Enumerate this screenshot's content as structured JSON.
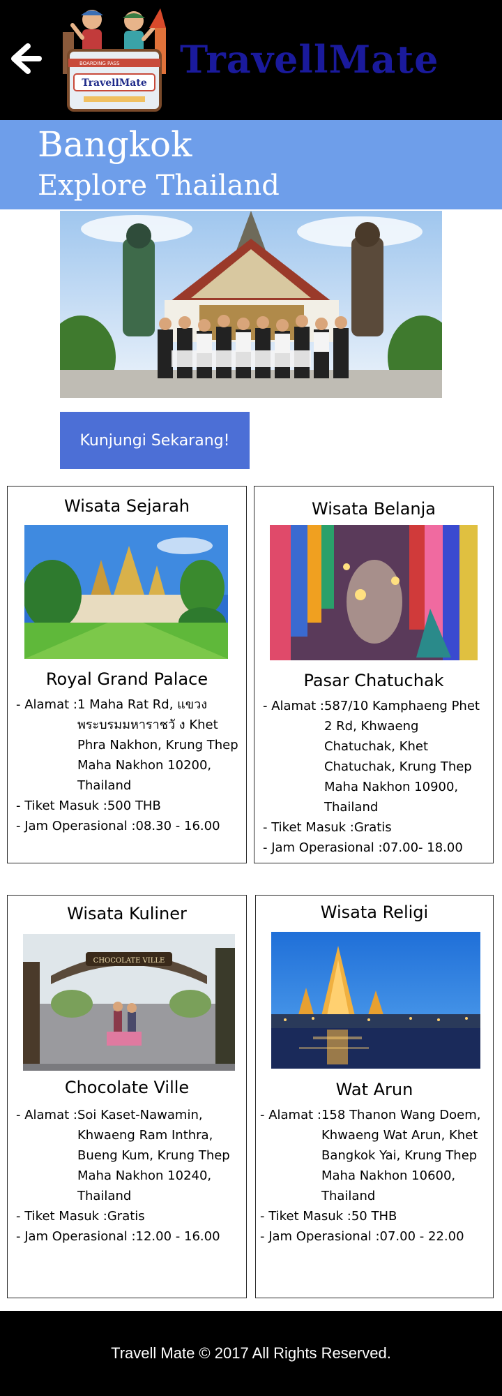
{
  "header": {
    "brand": "TravellMate",
    "logo_text": "TravellMate",
    "logo_ticket": "BOARDING PASS"
  },
  "hero": {
    "title": "Bangkok",
    "subtitle": "Explore Thailand",
    "cta": "Kunjungi Sekarang!"
  },
  "cards": [
    {
      "title": "Wisata Sejarah",
      "name": "Royal Grand Palace",
      "address": "1 Maha Rat Rd, แขวงพระบรมมหาราชวั ง Khet Phra Nakhon, Krung Thep Maha Nakhon 10200, Thailand",
      "ticket": "500 THB",
      "hours": "08.30 - 16.00"
    },
    {
      "title": "Wisata Belanja",
      "name": "Pasar Chatuchak",
      "address": "587/10 Kamphaeng Phet 2 Rd, Khwaeng Chatuchak, Khet Chatuchak, Krung Thep Maha Nakhon 10900, Thailand",
      "ticket": "Gratis",
      "hours": "07.00- 18.00"
    },
    {
      "title": "Wisata Kuliner",
      "name": "Chocolate Ville",
      "address": "Soi Kaset-Nawamin, Khwaeng Ram Inthra, Bueng Kum, Krung Thep Maha Nakhon 10240, Thailand",
      "ticket": "Gratis",
      "hours": "12.00 - 16.00"
    },
    {
      "title": "Wisata Religi",
      "name": "Wat Arun",
      "address": "158 Thanon Wang Doem, Khwaeng Wat Arun, Khet Bangkok Yai, Krung Thep Maha Nakhon 10600, Thailand",
      "ticket": "50 THB",
      "hours": "07.00 - 22.00"
    }
  ],
  "labels": {
    "address": "- Alamat : ",
    "ticket": "- Tiket Masuk : ",
    "hours": "- Jam Operasional : "
  },
  "sign_text": "CHOCOLATE VILLE",
  "footer": "Travell Mate © 2017 All Rights Reserved."
}
